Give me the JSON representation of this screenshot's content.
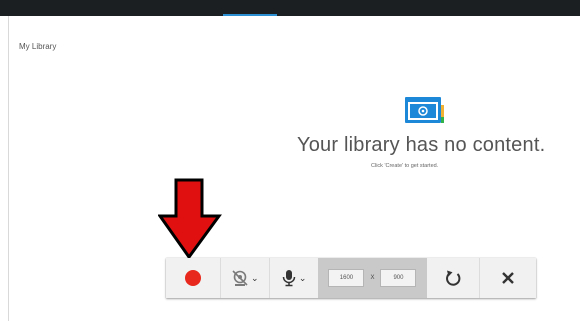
{
  "page": {
    "library_label": "My Library",
    "empty_title": "Your library has no content.",
    "empty_subtitle": "Click 'Create' to get started."
  },
  "toolbar": {
    "width_value": "1600",
    "height_value": "900",
    "dimension_separator": "X",
    "webcam_caret": "⌄",
    "mic_caret": "⌄"
  },
  "colors": {
    "record": "#e8281c",
    "arrow": "#e01010",
    "accent": "#2b8fd1"
  },
  "icons": [
    "record-icon",
    "webcam-off-icon",
    "microphone-icon",
    "refresh-icon",
    "close-icon",
    "library-empty-icon"
  ]
}
